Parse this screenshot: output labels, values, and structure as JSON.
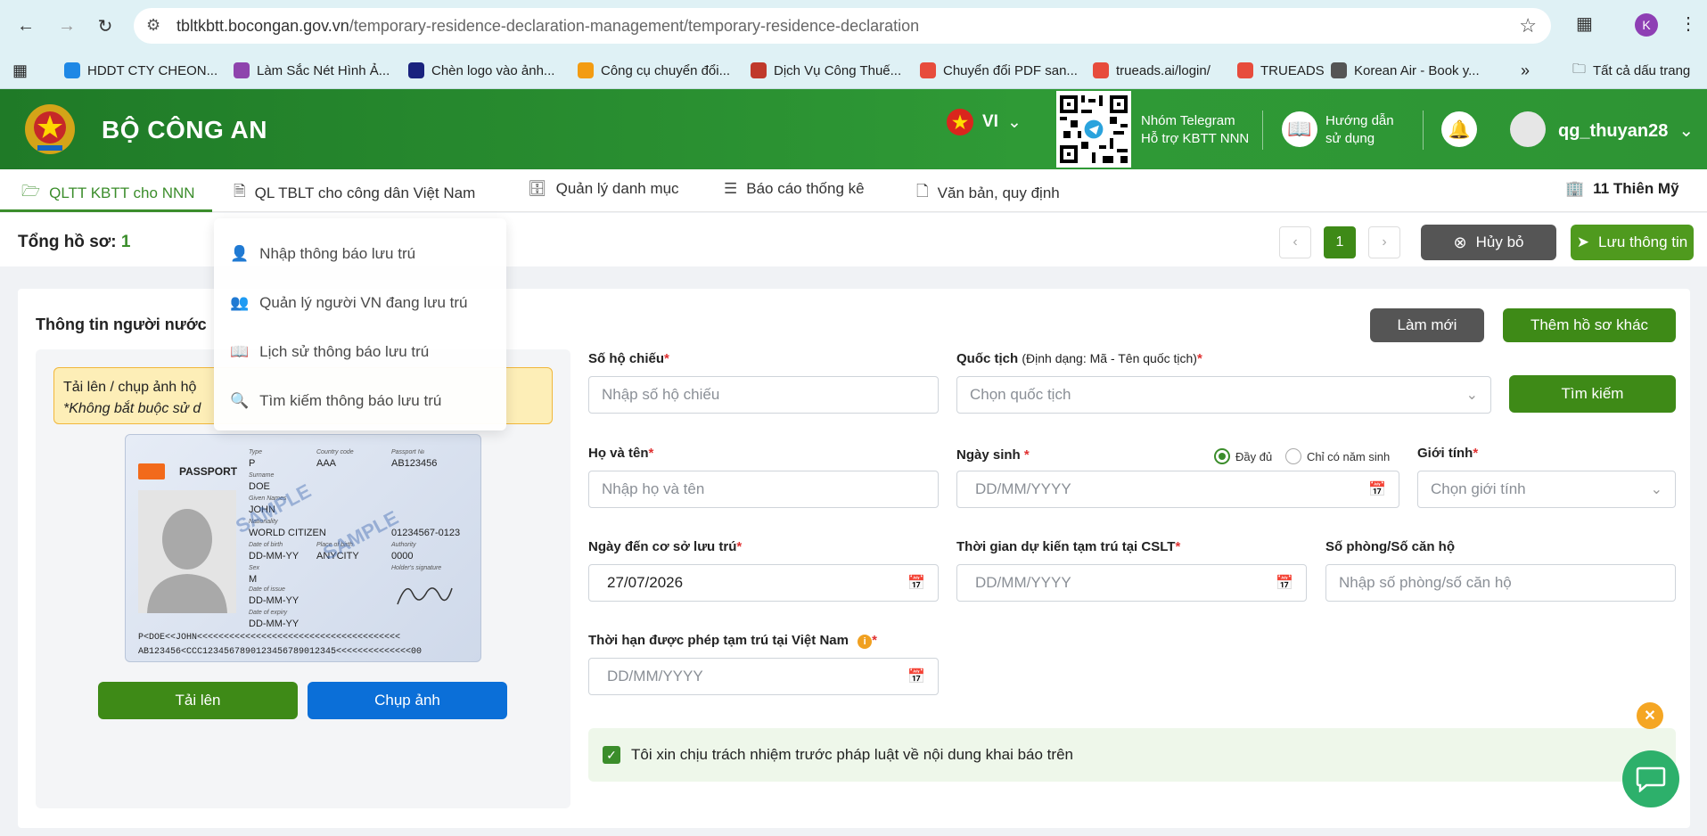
{
  "browser": {
    "url_domain": "tbltkbtt.bocongan.gov.vn",
    "url_path": "/temporary-residence-declaration-management/temporary-residence-declaration",
    "profile_initial": "K",
    "bookmarks": [
      {
        "label": "HDDT CTY CHEON...",
        "color": "#1e88e5"
      },
      {
        "label": "Làm Sắc Nét Hình Ả...",
        "color": "#8e44ad"
      },
      {
        "label": "Chèn logo vào ảnh...",
        "color": "#1a237e"
      },
      {
        "label": "Công cụ chuyển đổi...",
        "color": "#f39c12"
      },
      {
        "label": "Dịch Vụ Công Thuế...",
        "color": "#c0392b"
      },
      {
        "label": "Chuyển đổi PDF san...",
        "color": "#e74c3c"
      },
      {
        "label": "trueads.ai/login/",
        "color": "#e74c3c"
      },
      {
        "label": "TRUEADS",
        "color": "#e74c3c"
      },
      {
        "label": "Korean Air - Book y...",
        "color": "#555555"
      }
    ],
    "all_bookmarks": "Tất cả dấu trang"
  },
  "header": {
    "brand": "BỘ CÔNG AN",
    "lang": "VI",
    "telegram_line1": "Nhóm Telegram",
    "telegram_line2": "Hỗ trợ KBTT NNN",
    "guide_line1": "Hướng dẫn",
    "guide_line2": "sử dụng",
    "username": "qg_thuyan28"
  },
  "menu": {
    "items": [
      {
        "label": "QLTT KBTT cho NNN"
      },
      {
        "label": "QL TBLT cho công dân Việt Nam"
      },
      {
        "label": "Quản lý danh mục"
      },
      {
        "label": "Báo cáo thống kê"
      },
      {
        "label": "Văn bản, quy định"
      }
    ],
    "location": "11 Thiên Mỹ",
    "dropdown": [
      {
        "label": "Nhập thông báo lưu trú"
      },
      {
        "label": "Quản lý người VN đang lưu trú"
      },
      {
        "label": "Lịch sử thông báo lưu trú"
      },
      {
        "label": "Tìm kiếm thông báo lưu trú"
      }
    ]
  },
  "toolbar": {
    "total_label": "Tổng hồ sơ:",
    "total_value": "1",
    "page": "1",
    "cancel": "Hủy bỏ",
    "save": "Lưu thông tin"
  },
  "form": {
    "title": "Thông tin người nước",
    "refresh": "Làm mới",
    "add_other": "Thêm hồ sơ khác",
    "upload_note_1": "Tải lên / chụp ảnh hộ",
    "upload_note_2": "*Không bắt buộc sử d",
    "upload_btn": "Tải lên",
    "capture_btn": "Chụp ảnh",
    "passport": {
      "heading": "PASSPORT",
      "type_label": "Type",
      "type": "P",
      "country_label": "Country code",
      "country": "AAA",
      "no_label": "Passport №",
      "no": "AB123456",
      "surname_label": "Surname",
      "surname": "DOE",
      "given_label": "Given Names",
      "given": "JOHN",
      "nationality_label": "Nationality",
      "nationality": "WORLD CITIZEN",
      "dob_label": "Date of birth",
      "dob": "DD-MM-YY",
      "pob_label": "Place of birth",
      "pob": "ANYCITY",
      "personal_no": "01234567-0123",
      "authority_label": "Authority",
      "authority": "0000",
      "sex_label": "Sex",
      "sex": "M",
      "holder_sig_label": "Holder's signature",
      "issue_label": "Date of issue",
      "issue": "DD-MM-YY",
      "expiry_label": "Date of expiry",
      "expiry": "DD-MM-YY",
      "sample": "SAMPLE",
      "mrz1": "P<DOE<<JOHN<<<<<<<<<<<<<<<<<<<<<<<<<<<<<<<<<<<<<<",
      "mrz2": "AB123456<CCC1234567890123456789012345<<<<<<<<<<<<<<00"
    },
    "passport_no_label": "Số hộ chiếu",
    "passport_no_ph": "Nhập số hộ chiếu",
    "nationality_label": "Quốc tịch",
    "nationality_hint": "(Định dạng: Mã - Tên quốc tịch)",
    "nationality_ph": "Chọn quốc tịch",
    "search": "Tìm kiếm",
    "fullname_label": "Họ và tên",
    "fullname_ph": "Nhập họ và tên",
    "dob_label": "Ngày sinh",
    "dob_full": "Đầy đủ",
    "dob_year": "Chỉ có năm sinh",
    "dob_ph": "DD/MM/YYYY",
    "gender_label": "Giới tính",
    "gender_ph": "Chọn giới tính",
    "arrival_label": "Ngày đến cơ sở lưu trú",
    "arrival_value": "27/07/2026",
    "stay_label": "Thời gian dự kiến tạm trú tại CSLT",
    "stay_ph": "DD/MM/YYYY",
    "room_label": "Số phòng/Số căn hộ",
    "room_ph": "Nhập số phòng/số căn hộ",
    "permit_label": "Thời hạn được phép tạm trú tại Việt Nam",
    "permit_ph": "DD/MM/YYYY",
    "confirm": "Tôi xin chịu trách nhiệm trước pháp luật về nội dung khai báo trên"
  },
  "colors": {
    "primary": "#3b8d2b",
    "header": "#2f9a36",
    "blue": "#0b6fd8",
    "dark": "#555555"
  }
}
